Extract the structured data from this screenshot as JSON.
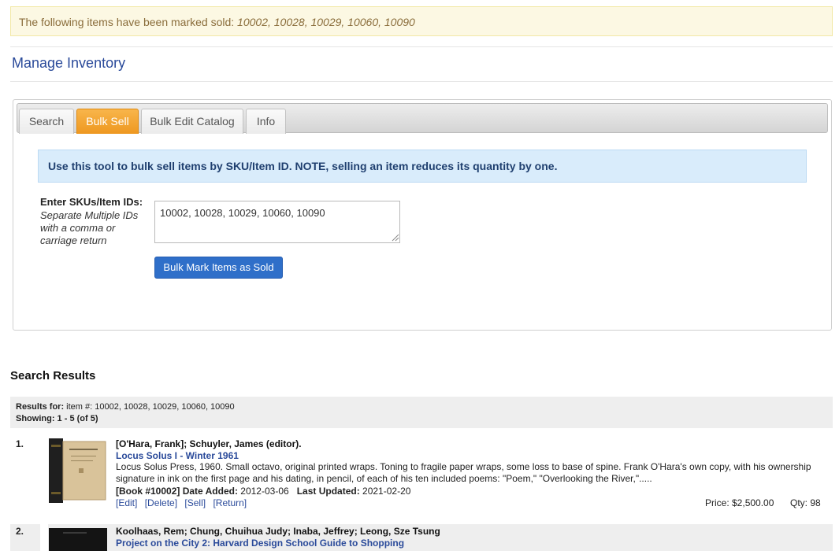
{
  "alert": {
    "prefix": "The following items have been marked sold: ",
    "ids": "10002, 10028, 10029, 10060, 10090"
  },
  "page_title": "Manage Inventory",
  "tabs": [
    {
      "label": "Search"
    },
    {
      "label": "Bulk Sell"
    },
    {
      "label": "Bulk Edit Catalog"
    },
    {
      "label": "Info"
    }
  ],
  "bulk_sell": {
    "info": "Use this tool to bulk sell items by SKU/Item ID. NOTE, selling an item reduces its quantity by one.",
    "field_label": "Enter SKUs/Item IDs:",
    "field_hint": "Separate Multiple IDs with a comma or carriage return",
    "field_value": "10002, 10028, 10029, 10060, 10090",
    "button_label": "Bulk Mark Items as Sold"
  },
  "results": {
    "title": "Search Results",
    "results_for_label": "Results for:",
    "results_for_value": " item #: 10002, 10028, 10029, 10060, 10090",
    "showing_label": "Showing:",
    "showing_value": " 1 - 5 (of 5)",
    "items": [
      {
        "num": "1.",
        "author": "[O'Hara, Frank]; Schuyler, James (editor).",
        "title": "Locus Solus I - Winter 1961",
        "desc": "Locus Solus Press, 1960. Small octavo, original printed wraps. Toning to fragile paper wraps, some loss to base of spine. Frank O'Hara's own copy, with his ownership signature in ink on the first page and his dating, in pencil, of each of his ten included poems: \"Poem,\" \"Overlooking the River,\".....",
        "book_label": "[Book #10002]",
        "date_added_label": "Date Added:",
        "date_added": " 2012-03-06",
        "last_updated_label": "Last Updated:",
        "last_updated": " 2021-02-20",
        "links": [
          "[Edit]",
          "[Delete]",
          "[Sell]",
          "[Return]"
        ],
        "price": "Price: $2,500.00",
        "qty": "Qty: 98"
      },
      {
        "num": "2.",
        "author": "Koolhaas, Rem; Chung, Chuihua Judy; Inaba, Jeffrey; Leong, Sze Tsung",
        "title": "Project on the City 2: Harvard Design School Guide to Shopping"
      }
    ]
  }
}
